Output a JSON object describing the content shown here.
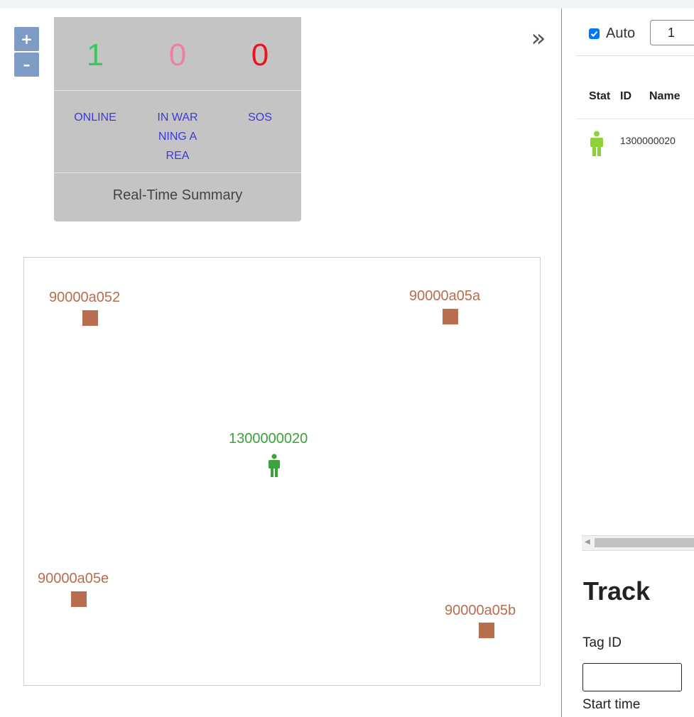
{
  "colors": {
    "online": "#33cc5a",
    "warning": "#f07fa8",
    "sos": "#e8141e",
    "label_blue": "#3a3ad9",
    "anchor": "#b86d4e",
    "tag": "#3aa33a",
    "tag_light": "#8dd13a",
    "zoom_button": "#7d9bc4",
    "summary_bg": "#c4c4c4"
  },
  "zoom": {
    "in_label": "+",
    "out_label": "–"
  },
  "summary": {
    "counts": [
      {
        "value": "1",
        "color": "#33cc5a"
      },
      {
        "value": "0",
        "color": "#f07fa8"
      },
      {
        "value": "0",
        "color": "#e8141e"
      }
    ],
    "labels": [
      "ONLINE",
      "IN WARNING AREA",
      "SOS"
    ],
    "title": "Real-Time Summary"
  },
  "collapse_icon": "double-chevron-right",
  "collapse_glyph": "»",
  "map": {
    "anchors": [
      {
        "id": "90000a052"
      },
      {
        "id": "90000a05a"
      },
      {
        "id": "90000a05e"
      },
      {
        "id": "90000a05b"
      }
    ],
    "tags": [
      {
        "id": "1300000020",
        "icon": "person-icon"
      }
    ]
  },
  "list": {
    "auto_label": "Auto",
    "auto_checked": true,
    "page_value": "1",
    "columns": [
      "Stat",
      "ID",
      "Name"
    ],
    "rows": [
      {
        "status_icon": "person-icon",
        "id": "1300000020",
        "name": ""
      }
    ]
  },
  "track": {
    "title": "Track",
    "tag_id_label": "Tag ID",
    "tag_id_value": "",
    "start_time_label": "Start time"
  }
}
